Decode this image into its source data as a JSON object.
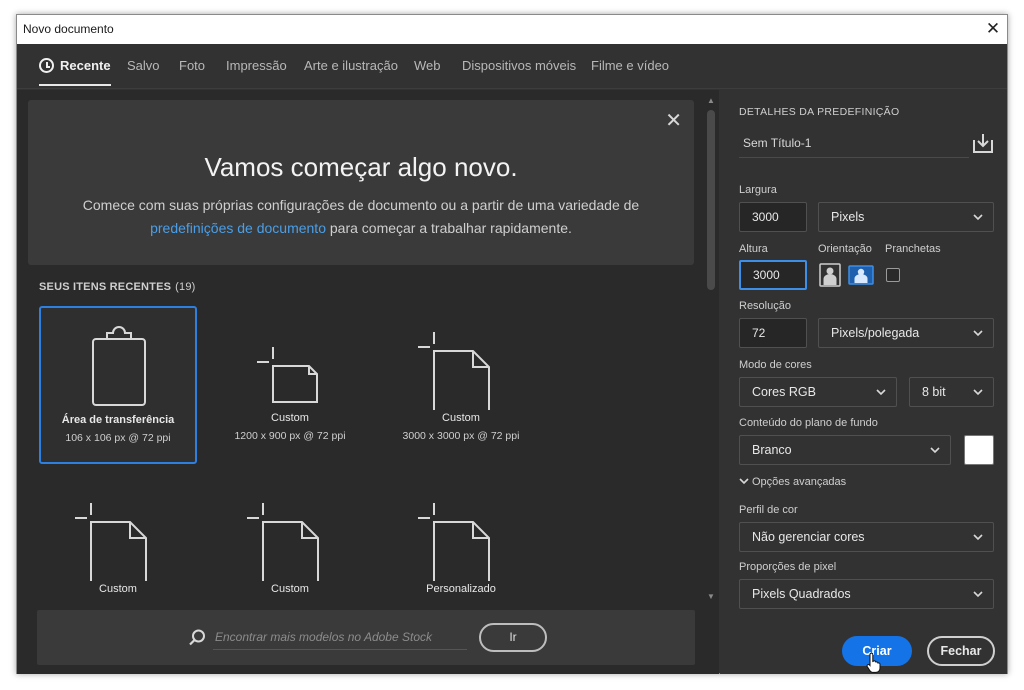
{
  "window": {
    "title": "Novo documento"
  },
  "tabs": [
    {
      "label": "Recente",
      "active": true
    },
    {
      "label": "Salvo"
    },
    {
      "label": "Foto"
    },
    {
      "label": "Impressão"
    },
    {
      "label": "Arte e ilustração"
    },
    {
      "label": "Web"
    },
    {
      "label": "Dispositivos móveis"
    },
    {
      "label": "Filme e vídeo"
    }
  ],
  "welcome": {
    "heading": "Vamos começar algo novo.",
    "text_before": "Comece com suas próprias configurações de documento ou a partir de uma variedade de ",
    "link": "predefinições de documento",
    "text_after": " para começar a trabalhar rapidamente."
  },
  "recent": {
    "heading": "SEUS ITENS RECENTES",
    "count": "(19)",
    "items": [
      {
        "name": "Área de transferência",
        "dims": "106 x 106 px @ 72 ppi",
        "icon": "clipboard-icon"
      },
      {
        "name": "Custom",
        "dims": "1200 x 900 px @ 72 ppi",
        "icon": "document-landscape-icon"
      },
      {
        "name": "Custom",
        "dims": "3000 x 3000 px @ 72 ppi",
        "icon": "document-icon"
      },
      {
        "name": "Custom",
        "dims": "",
        "icon": "document-icon"
      },
      {
        "name": "Custom",
        "dims": "",
        "icon": "document-icon"
      },
      {
        "name": "Personalizado",
        "dims": "",
        "icon": "document-icon"
      }
    ]
  },
  "search": {
    "placeholder": "Encontrar mais modelos no Adobe Stock",
    "go_label": "Ir"
  },
  "preset": {
    "section_title": "DETALHES DA PREDEFINIÇÃO",
    "doc_name": "Sem Título-1",
    "width_label": "Largura",
    "width_value": "3000",
    "width_unit": "Pixels",
    "height_label": "Altura",
    "height_value": "3000",
    "orientation_label": "Orientação",
    "artboards_label": "Pranchetas",
    "resolution_label": "Resolução",
    "resolution_value": "72",
    "resolution_unit": "Pixels/polegada",
    "color_mode_label": "Modo de cores",
    "color_mode": "Cores RGB",
    "bit_depth": "8 bit",
    "background_label": "Conteúdo do plano de fundo",
    "background": "Branco",
    "background_swatch": "#ffffff",
    "advanced_label": "Opções avançadas",
    "color_profile_label": "Perfil de cor",
    "color_profile": "Não gerenciar cores",
    "pixel_aspect_label": "Proporções de pixel",
    "pixel_aspect": "Pixels Quadrados"
  },
  "buttons": {
    "create": "Criar",
    "close": "Fechar"
  },
  "colors": {
    "accent": "#1473e6",
    "link": "#4a9fe8",
    "panel": "#323232",
    "content": "#2a2a2a"
  }
}
